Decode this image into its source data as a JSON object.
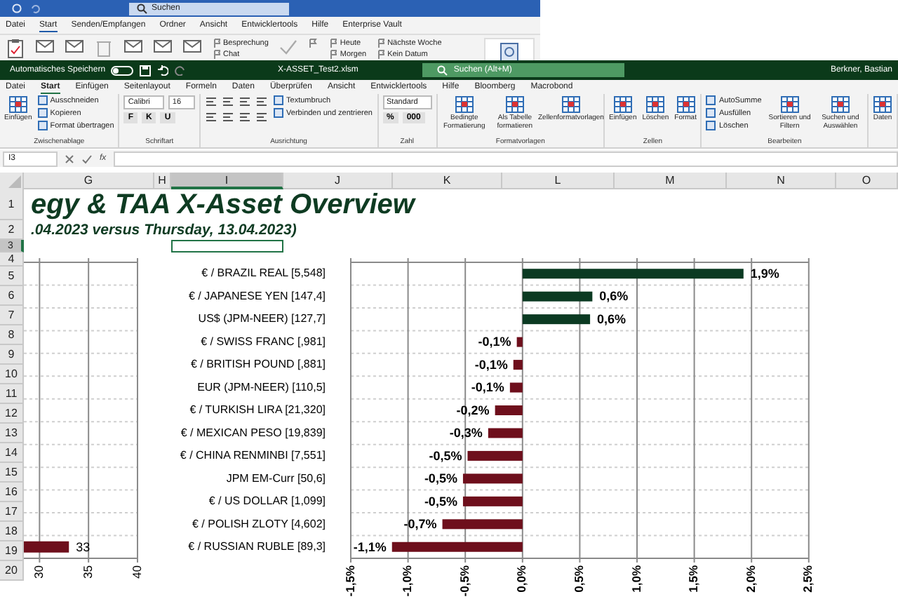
{
  "outlook_window": {
    "search": "Suchen",
    "tabs": [
      {
        "label": "Datei",
        "selected": false
      },
      {
        "label": "Start",
        "selected": true
      },
      {
        "label": "Senden/Empfangen",
        "selected": false
      },
      {
        "label": "Ordner",
        "selected": false
      },
      {
        "label": "Ansicht",
        "selected": false
      },
      {
        "label": "Entwicklertools",
        "selected": false
      },
      {
        "label": "Hilfe",
        "selected": false
      },
      {
        "label": "Enterprise Vault",
        "selected": false
      }
    ],
    "ribbon_columns": [
      [
        "Besprechung",
        "Chat"
      ],
      [
        "Heute",
        "Morgen"
      ],
      [
        "Nächste Woche",
        "Kein Datum"
      ]
    ]
  },
  "excel_window": {
    "title_bar": {
      "autosave_label": "Automatisches Speichern",
      "autosave_on": false,
      "filename": "X-ASSET_Test2.xlsm",
      "search": "Suchen (Alt+M)",
      "user": "Berkner, Bastian"
    },
    "tabs": [
      {
        "label": "Datei",
        "selected": false
      },
      {
        "label": "Start",
        "selected": true
      },
      {
        "label": "Einfügen",
        "selected": false
      },
      {
        "label": "Seitenlayout",
        "selected": false
      },
      {
        "label": "Formeln",
        "selected": false
      },
      {
        "label": "Daten",
        "selected": false
      },
      {
        "label": "Überprüfen",
        "selected": false
      },
      {
        "label": "Ansicht",
        "selected": false
      },
      {
        "label": "Entwicklertools",
        "selected": false
      },
      {
        "label": "Hilfe",
        "selected": false
      },
      {
        "label": "Bloomberg",
        "selected": false
      },
      {
        "label": "Macrobond",
        "selected": false
      }
    ],
    "ribbon_groups": [
      {
        "label": "Zwischenablage",
        "columns": [
          [
            {
              "kind": "large",
              "label": "Einfügen"
            }
          ],
          [
            {
              "kind": "small",
              "label": "Ausschneiden"
            },
            {
              "kind": "small",
              "label": "Kopieren"
            },
            {
              "kind": "small",
              "label": "Format übertragen"
            }
          ]
        ]
      },
      {
        "label": "Schriftart",
        "columns": [
          [
            {
              "kind": "row",
              "items": [
                {
                  "kind": "dropdown",
                  "value": "Calibri"
                },
                {
                  "kind": "dropdown",
                  "value": "16"
                }
              ]
            },
            {
              "kind": "letters",
              "letters": [
                "F",
                "K",
                "U"
              ]
            }
          ]
        ]
      },
      {
        "label": "Ausrichtung",
        "columns": [
          [
            {
              "kind": "icons"
            },
            {
              "kind": "icons"
            }
          ],
          [
            {
              "kind": "small",
              "label": "Textumbruch"
            },
            {
              "kind": "small",
              "label": "Verbinden und zentrieren"
            }
          ]
        ]
      },
      {
        "label": "Zahl",
        "columns": [
          [
            {
              "kind": "dropdown",
              "value": "Standard"
            },
            {
              "kind": "letters",
              "letters": [
                "%",
                "000"
              ]
            }
          ]
        ]
      },
      {
        "label": "Formatvorlagen",
        "columns": [
          [
            {
              "kind": "large",
              "label": "Bedingte Formatierung"
            }
          ],
          [
            {
              "kind": "large",
              "label": "Als Tabelle formatieren"
            }
          ],
          [
            {
              "kind": "large",
              "label": "Zellenformatvorlagen"
            }
          ]
        ]
      },
      {
        "label": "Zellen",
        "columns": [
          [
            {
              "kind": "large",
              "label": "Einfügen"
            }
          ],
          [
            {
              "kind": "large",
              "label": "Löschen"
            }
          ],
          [
            {
              "kind": "large",
              "label": "Format"
            }
          ]
        ]
      },
      {
        "label": "Bearbeiten",
        "columns": [
          [
            {
              "kind": "small",
              "label": "AutoSumme"
            },
            {
              "kind": "small",
              "label": "Ausfüllen"
            },
            {
              "kind": "small",
              "label": "Löschen"
            }
          ],
          [
            {
              "kind": "large",
              "label": "Sortieren und Filtern"
            }
          ],
          [
            {
              "kind": "large",
              "label": "Suchen und Auswählen"
            }
          ]
        ]
      },
      {
        "columns": [
          [
            {
              "kind": "large",
              "label": "Daten"
            }
          ]
        ]
      }
    ],
    "formula_bar": {
      "name_box": "I3",
      "function_label": "fx"
    },
    "sheet": {
      "columns": [
        {
          "label": "G",
          "selected": false
        },
        {
          "label": "H",
          "selected": false
        },
        {
          "label": "I",
          "selected": true
        },
        {
          "label": "J",
          "selected": false
        },
        {
          "label": "K",
          "selected": false
        },
        {
          "label": "L",
          "selected": false
        },
        {
          "label": "M",
          "selected": false
        },
        {
          "label": "N",
          "selected": false
        },
        {
          "label": "O",
          "selected": false
        }
      ],
      "rows": [
        {
          "label": "1",
          "selected": false
        },
        {
          "label": "2",
          "selected": false
        },
        {
          "label": "3",
          "selected": true
        },
        {
          "label": "4",
          "selected": false
        },
        {
          "label": "5",
          "selected": false
        },
        {
          "label": "6",
          "selected": false
        },
        {
          "label": "7",
          "selected": false
        },
        {
          "label": "8",
          "selected": false
        },
        {
          "label": "9",
          "selected": false
        },
        {
          "label": "10",
          "selected": false
        },
        {
          "label": "11",
          "selected": false
        },
        {
          "label": "12",
          "selected": false
        },
        {
          "label": "13",
          "selected": false
        },
        {
          "label": "14",
          "selected": false
        },
        {
          "label": "15",
          "selected": false
        },
        {
          "label": "16",
          "selected": false
        },
        {
          "label": "17",
          "selected": false
        },
        {
          "label": "18",
          "selected": false
        },
        {
          "label": "19",
          "selected": false
        },
        {
          "label": "20",
          "selected": false
        }
      ],
      "title": "egy & TAA X-Asset Overview",
      "subtitle": ".04.2023 versus Thursday, 13.04.2023)",
      "charts": [
        {
          "chart_data": {
            "type": "bar",
            "orientation": "horizontal",
            "grid": true,
            "xlim": [
              28.4,
              40
            ],
            "xticks": [
              30,
              35,
              40
            ],
            "series": [
              {
                "color": "#6e0f1c",
                "values": [
                  null,
                  null,
                  null,
                  null,
                  null,
                  null,
                  null,
                  null,
                  null,
                  null,
                  null,
                  null,
                  33
                ]
              }
            ],
            "value_labels": [
              null,
              null,
              null,
              null,
              null,
              null,
              null,
              null,
              null,
              null,
              null,
              null,
              "33"
            ]
          }
        },
        {
          "chart_data": {
            "type": "bar",
            "orientation": "horizontal",
            "grid": true,
            "categories": [
              "€ / BRAZIL REAL [5,548]",
              "€ / JAPANESE YEN [147,4]",
              "US$ (JPM-NEER) [127,7]",
              "€ / SWISS FRANC [,981]",
              "€ / BRITISH POUND [,881]",
              "EUR (JPM-NEER) [110,5]",
              "€ / TURKISH LIRA [21,320]",
              "€ / MEXICAN PESO [19,839]",
              "€ / CHINA RENMINBI [7,551]",
              "JPM EM-Curr [50,6]",
              "€ / US DOLLAR [1,099]",
              "€ / POLISH ZLOTY [4,602]",
              "€ / RUSSIAN RUBLE [89,3]"
            ],
            "series": [
              {
                "color": "#0b3a22",
                "values": [
                  1.93,
                  0.61,
                  0.59,
                  null,
                  null,
                  null,
                  null,
                  null,
                  null,
                  null,
                  null,
                  null,
                  null
                ]
              },
              {
                "color": "#6e0f1c",
                "values": [
                  null,
                  null,
                  null,
                  -0.05,
                  -0.08,
                  -0.11,
                  -0.24,
                  -0.3,
                  -0.48,
                  -0.52,
                  -0.52,
                  -0.7,
                  -1.14
                ]
              }
            ],
            "xlim": [
              -1.5,
              2.5
            ],
            "xticks": [
              {
                "value": -1.5,
                "label": "-1,5%"
              },
              {
                "value": -1,
                "label": "-1,0%"
              },
              {
                "value": -0.5,
                "label": "-0,5%"
              },
              {
                "value": 0,
                "label": "0,0%"
              },
              {
                "value": 0.5,
                "label": "0,5%"
              },
              {
                "value": 1,
                "label": "1,0%"
              },
              {
                "value": 1.5,
                "label": "1,5%"
              },
              {
                "value": 2,
                "label": "2,0%"
              },
              {
                "value": 2.5,
                "label": "2,5%"
              }
            ],
            "value_labels": [
              "1,9%",
              "0,6%",
              "0,6%",
              "-0,1%",
              "-0,1%",
              "-0,1%",
              "-0,2%",
              "-0,3%",
              "-0,5%",
              "-0,5%",
              "-0,5%",
              "-0,7%",
              "-1,1%"
            ]
          }
        }
      ]
    }
  }
}
